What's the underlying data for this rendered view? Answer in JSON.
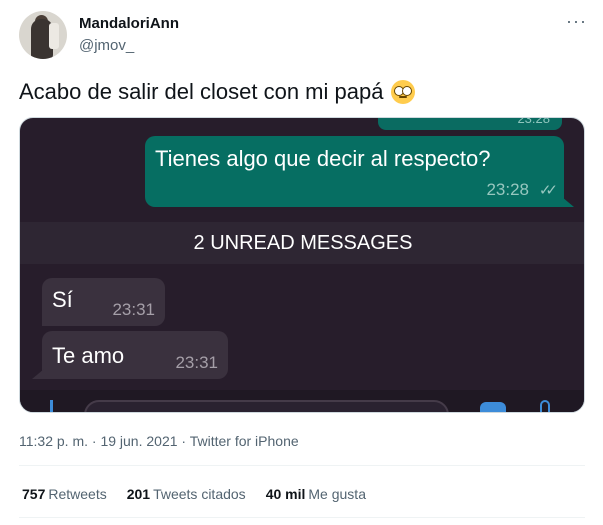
{
  "author": {
    "name": "MandaloriAnn",
    "handle": "@jmov_"
  },
  "more_icon": "···",
  "tweet_text": "Acabo de salir del closet con mi papá",
  "emoji": "face-with-rolling-eyes-emoji",
  "chat": {
    "top_time": "23:28",
    "outgoing_message": "Tienes algo que decir al respecto?",
    "outgoing_time": "23:28",
    "read_ticks": "✓✓",
    "unread_banner": "2 UNREAD MESSAGES",
    "incoming": [
      {
        "text": "Sí",
        "time": "23:31"
      },
      {
        "text": "Te amo",
        "time": "23:31"
      }
    ]
  },
  "meta": "11:32 p. m. · 19 jun. 2021 · Twitter for iPhone",
  "stats": [
    {
      "count": "757",
      "label": "Retweets"
    },
    {
      "count": "201",
      "label": "Tweets citados"
    },
    {
      "count": "40 mil",
      "label": "Me gusta"
    }
  ],
  "colors": {
    "outgoing_bubble": "#066e62",
    "chat_background": "#271d2b",
    "secondary_text": "#536471"
  }
}
